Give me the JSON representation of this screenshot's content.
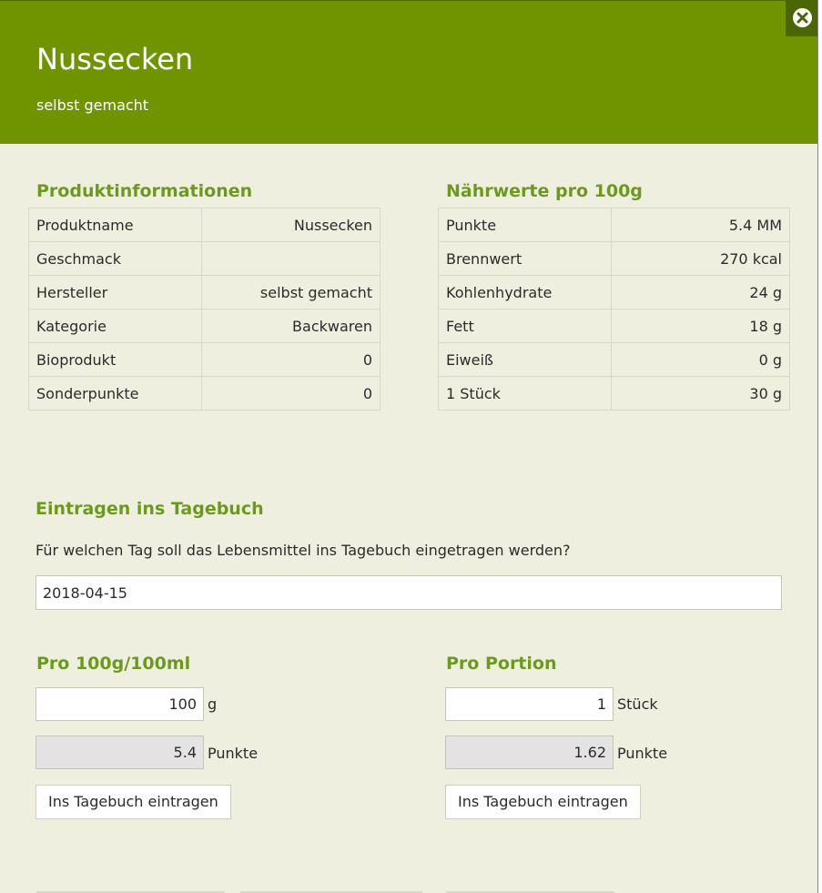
{
  "header": {
    "title": "Nussecken",
    "subtitle": "selbst gemacht"
  },
  "colors": {
    "header_bg": "#6f9400",
    "accent": "#6c9a1d",
    "background": "#efefe0"
  },
  "icons": {
    "close": "close-icon"
  },
  "product_info": {
    "title": "Produktinformationen",
    "rows": [
      {
        "label": "Produktname",
        "value": "Nussecken"
      },
      {
        "label": "Geschmack",
        "value": ""
      },
      {
        "label": "Hersteller",
        "value": "selbst gemacht"
      },
      {
        "label": "Kategorie",
        "value": "Backwaren"
      },
      {
        "label": "Bioprodukt",
        "value": "0"
      },
      {
        "label": "Sonderpunkte",
        "value": "0"
      }
    ]
  },
  "nutrition": {
    "title": "Nährwerte pro 100g",
    "rows": [
      {
        "label": "Punkte",
        "value": "5.4 MM"
      },
      {
        "label": "Brennwert",
        "value": "270 kcal"
      },
      {
        "label": "Kohlenhydrate",
        "value": "24 g"
      },
      {
        "label": "Fett",
        "value": "18 g"
      },
      {
        "label": "Eiweiß",
        "value": "0 g"
      },
      {
        "label": "1 Stück",
        "value": "30 g"
      }
    ]
  },
  "diary": {
    "title": "Eintragen ins Tagebuch",
    "prompt": "Für welchen Tag soll das Lebensmittel ins Tagebuch eingetragen werden?",
    "date": "2018-04-15"
  },
  "per100": {
    "title": "Pro 100g/100ml",
    "amount": "100",
    "amount_unit": "g",
    "points": "5.4",
    "points_label": "Punkte",
    "button": "Ins Tagebuch eintragen"
  },
  "portion": {
    "title": "Pro Portion",
    "amount": "1",
    "amount_unit": "Stück",
    "points": "1.62",
    "points_label": "Punkte",
    "button": "Ins Tagebuch eintragen"
  }
}
